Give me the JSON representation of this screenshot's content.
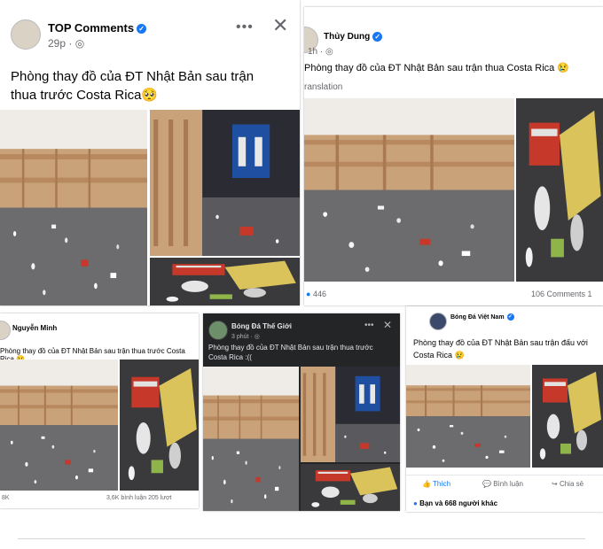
{
  "post1": {
    "page_name": "TOP Comments",
    "time": "29p",
    "caption": "Phòng thay đồ của ĐT Nhật Bản sau trận thua trước Costa Rica🥺",
    "more_icon": "more-horizontal-icon",
    "close_icon": "close-icon"
  },
  "post2": {
    "page_name": "Thủy Dung",
    "time": "1h",
    "caption": "Phòng thay đồ của ĐT Nhật Bản sau trận thua Costa Rica 😢",
    "translation": "ranslation",
    "reactions": "446",
    "comments": "106 Comments 1"
  },
  "post3": {
    "page_name": "Nguyễn Minh",
    "caption": "Phòng thay đồ của ĐT Nhật Bản sau trận thua trước Costa Rica 😢",
    "reactions": "8K",
    "comments": "3,6K bình luận  205 lượt"
  },
  "post4": {
    "page_name": "Bóng Đá Thế Giới",
    "time": "3 phút",
    "caption": "Phòng thay đồ của ĐT Nhật Bản sau trận thua trước Costa Rica :(("
  },
  "post5": {
    "page_name": "Bóng Đá Việt Nam",
    "caption": "Phòng thay đồ của ĐT Nhật Bản sau trận đấu với Costa Rica 😢",
    "like_label": "Thích",
    "comment_label": "Bình luận",
    "share_label": "Chia sẻ",
    "reactions_text": "Bạn và 668 người khác"
  },
  "colors": {
    "facebook_blue": "#1877f2",
    "dark_card": "#242526"
  }
}
